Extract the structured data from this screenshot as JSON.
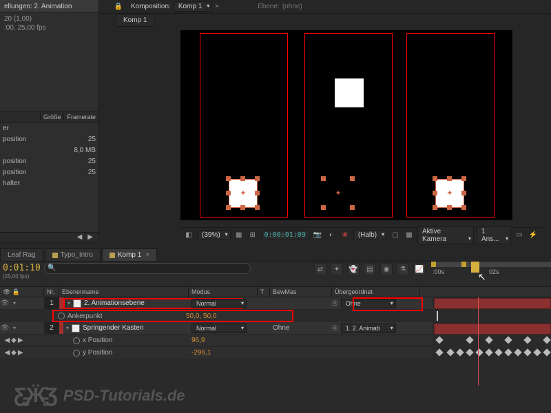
{
  "topbar": {
    "comp_label": "Komposition:",
    "comp_name": "Komp 1",
    "layer_label": "Ebene:",
    "layer_value": "(ohne)"
  },
  "breadcrumb": "Komp 1",
  "project_panel": {
    "header": "ellungen: 2. Animation",
    "info_line1": "20 (1,00)",
    "info_line2": ":00, 25,00 fps",
    "cols": {
      "size": "Größe",
      "framerate": "Framerate"
    },
    "rows": [
      {
        "name": "er",
        "val": ""
      },
      {
        "name": "position",
        "val": "25"
      },
      {
        "name": "",
        "val": "8,0 MB"
      },
      {
        "name": "position",
        "val": "25"
      },
      {
        "name": "position",
        "val": "25"
      },
      {
        "name": "halter",
        "val": ""
      }
    ]
  },
  "viewer_toolbar": {
    "zoom": "(39%)",
    "timecode": "0:00:01:09",
    "quality": "(Halb)",
    "camera": "Aktive Kamera",
    "views": "1 Ans..."
  },
  "timeline_tabs": {
    "t1": "Leaf Rag",
    "t2": "Typo_Intro",
    "t3": "Komp 1"
  },
  "timeline": {
    "current_time": "0:01:10",
    "current_frame": "(25,00 fps)",
    "search_placeholder": "",
    "ruler": {
      "t0": ":00s",
      "t1": "02s"
    },
    "cols": {
      "nr": "Nr.",
      "name": "Ebenenname",
      "mode": "Modus",
      "t": "T",
      "bew": "BewMas",
      "parent": "Übergeordnet"
    },
    "layers": [
      {
        "nr": "1",
        "color": "#a03030",
        "name": "2. Animationsebene",
        "mode": "Normal",
        "parent": "Ohne",
        "props": [
          {
            "name": "Ankerpunkt",
            "value": "50,0, 50,0"
          }
        ]
      },
      {
        "nr": "2",
        "color": "#a03030",
        "name": "Springender Kasten",
        "mode": "Normal",
        "bew": "Ohne",
        "parent": "1. 2. Animati",
        "props": [
          {
            "name": "x Position",
            "value": "96,9"
          },
          {
            "name": "y Position",
            "value": "-296,1"
          }
        ]
      }
    ]
  },
  "watermark": "PSD-Tutorials.de"
}
